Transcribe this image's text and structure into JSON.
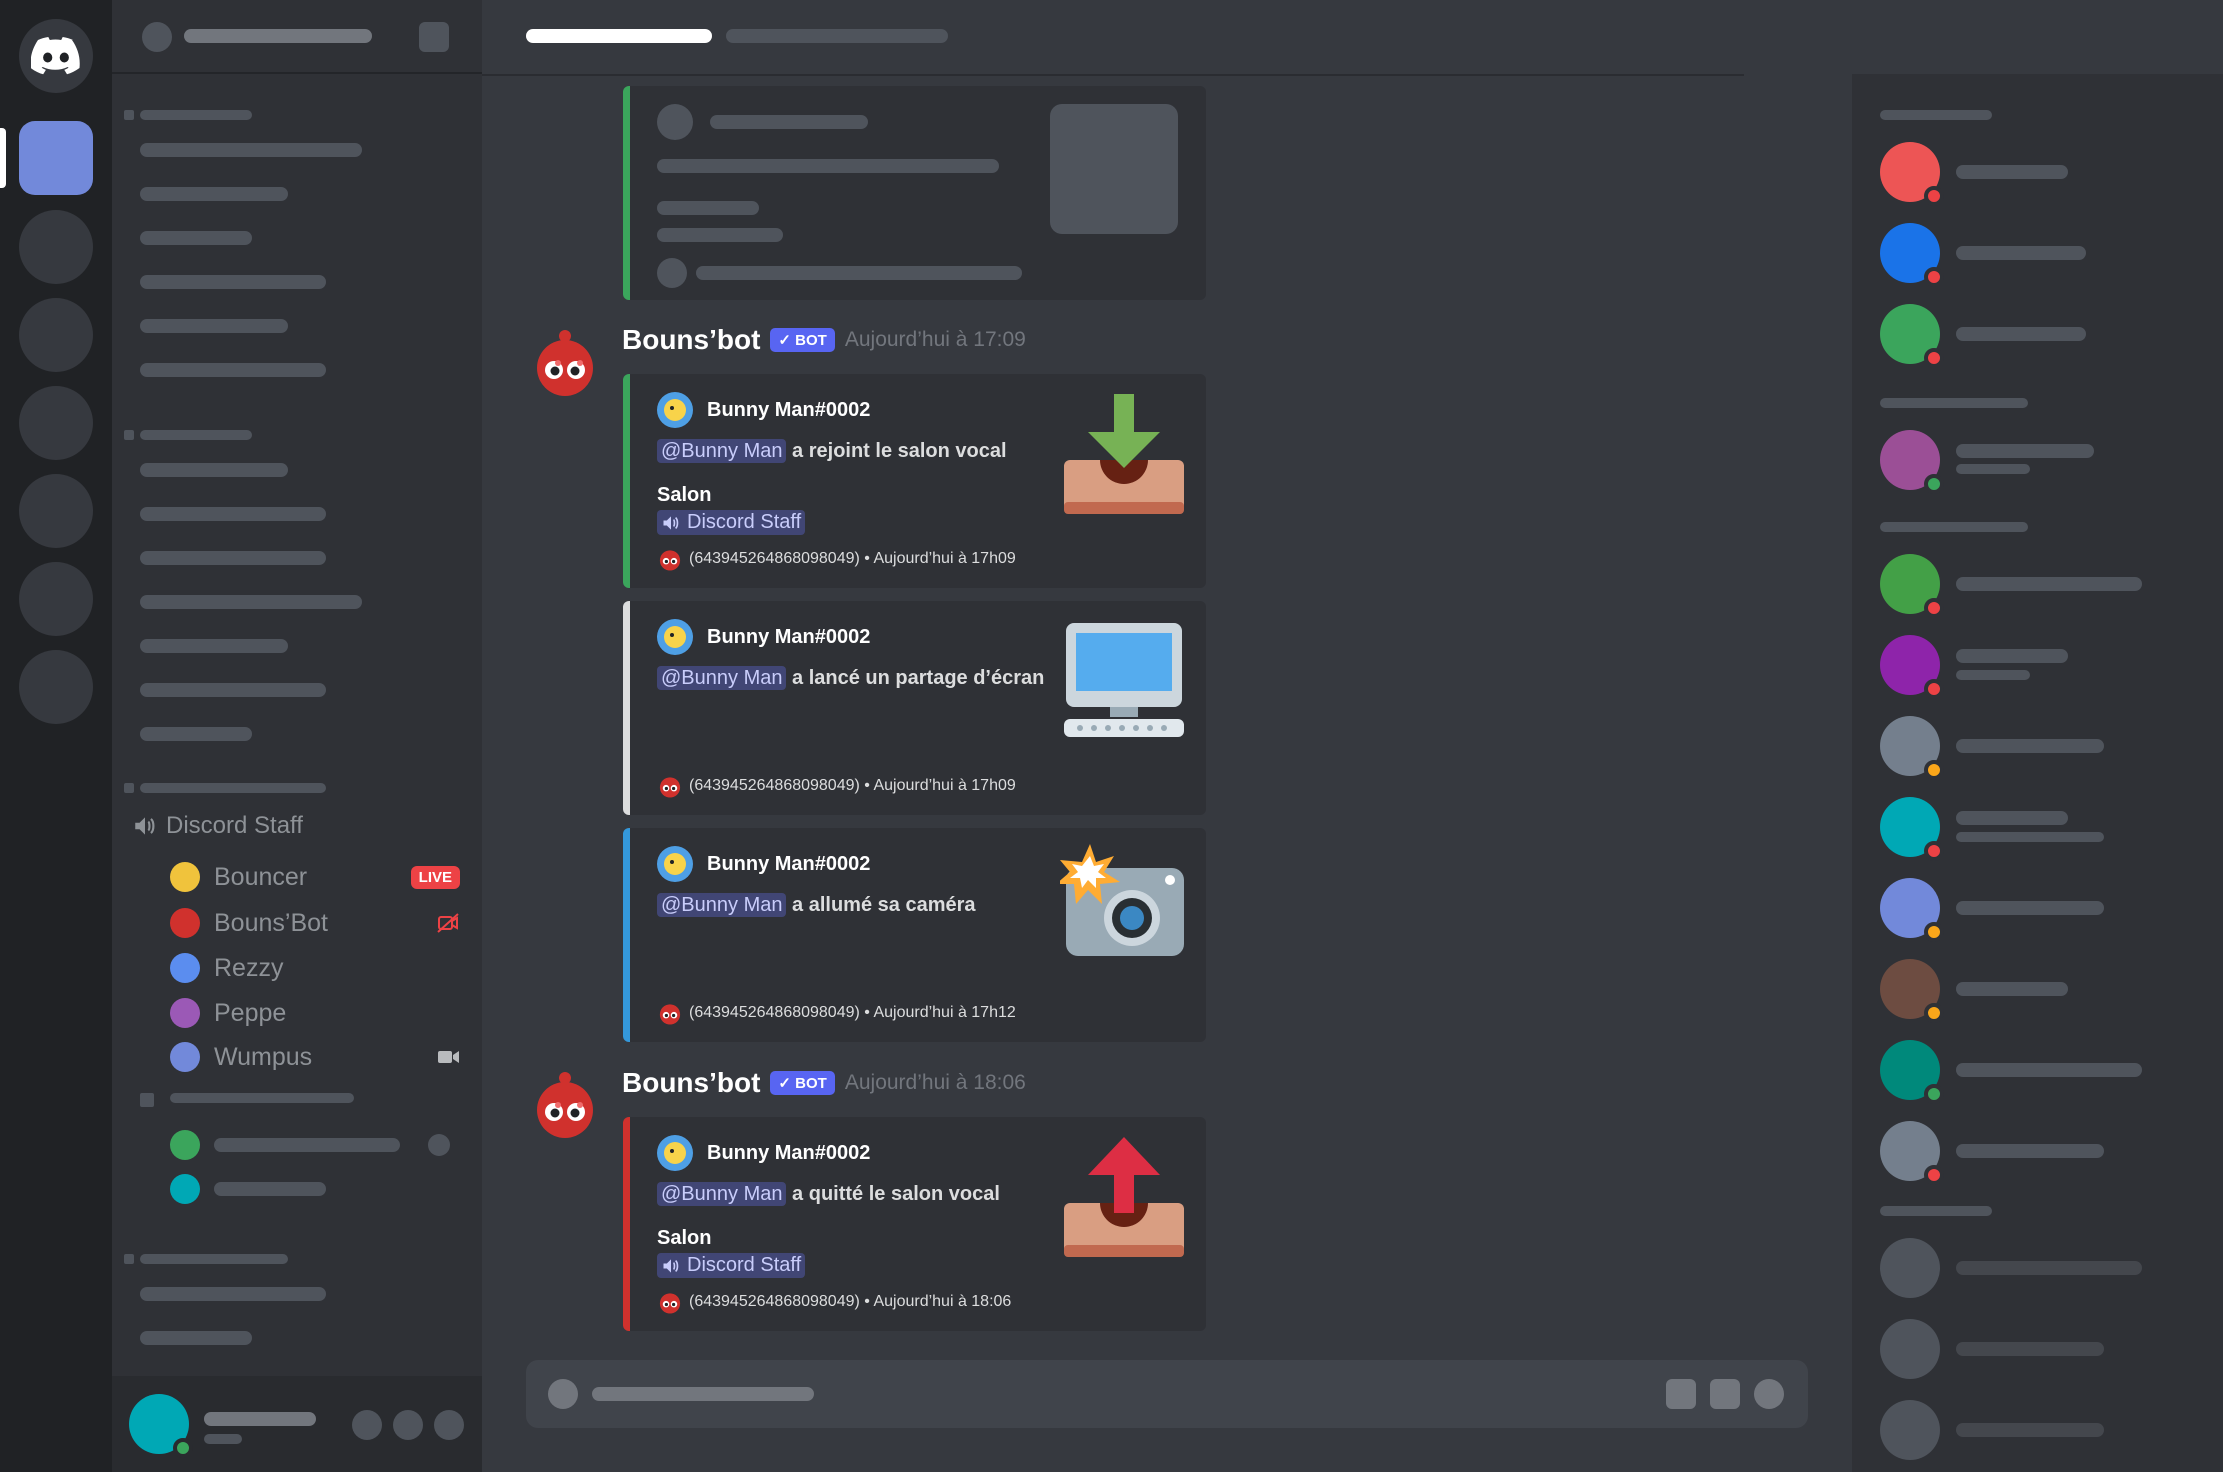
{
  "voice_channel": {
    "name": "Discord Staff",
    "users": [
      {
        "name": "Bouncer",
        "badge": "LIVE"
      },
      {
        "name": "Bouns’Bot"
      },
      {
        "name": "Rezzy"
      },
      {
        "name": "Peppe"
      },
      {
        "name": "Wumpus"
      }
    ]
  },
  "messages": [
    {
      "author": "Bouns’bot",
      "badge": "BOT",
      "time": "Aujourd’hui à 17:09",
      "embeds": [
        {
          "author": "Bunny Man#0002",
          "mention": "@Bunny Man",
          "text": "a rejoint le salon vocal",
          "field_name": "Salon",
          "field_value": "Discord Staff",
          "footer": "(643945264868098049) • Aujourd’hui à 17h09",
          "color": "#3ba55c",
          "thumbnail": "join-inbox-icon"
        },
        {
          "author": "Bunny Man#0002",
          "mention": "@Bunny Man",
          "text": "a lancé un partage d’écran",
          "footer": "(643945264868098049) • Aujourd’hui à 17h09",
          "color": "#dcddde",
          "thumbnail": "computer-screen-icon"
        },
        {
          "author": "Bunny Man#0002",
          "mention": "@Bunny Man",
          "text": "a allumé sa caméra",
          "footer": "(643945264868098049) • Aujourd’hui à 17h12",
          "color": "#3498db",
          "thumbnail": "camera-flash-icon"
        }
      ]
    },
    {
      "author": "Bouns’bot",
      "badge": "BOT",
      "time": "Aujourd’hui à 18:06",
      "embeds": [
        {
          "author": "Bunny Man#0002",
          "mention": "@Bunny Man",
          "text": "a quitté le salon vocal",
          "field_name": "Salon",
          "field_value": "Discord Staff",
          "footer": "(643945264868098049) • Aujourd’hui à 18:06",
          "color": "#d0312d",
          "thumbnail": "leave-inbox-icon"
        }
      ]
    }
  ],
  "colors": {
    "accent": "#5865f2",
    "live": "#ed4245",
    "online": "#3ba55c",
    "dnd": "#ed4245",
    "idle": "#faa61a"
  }
}
